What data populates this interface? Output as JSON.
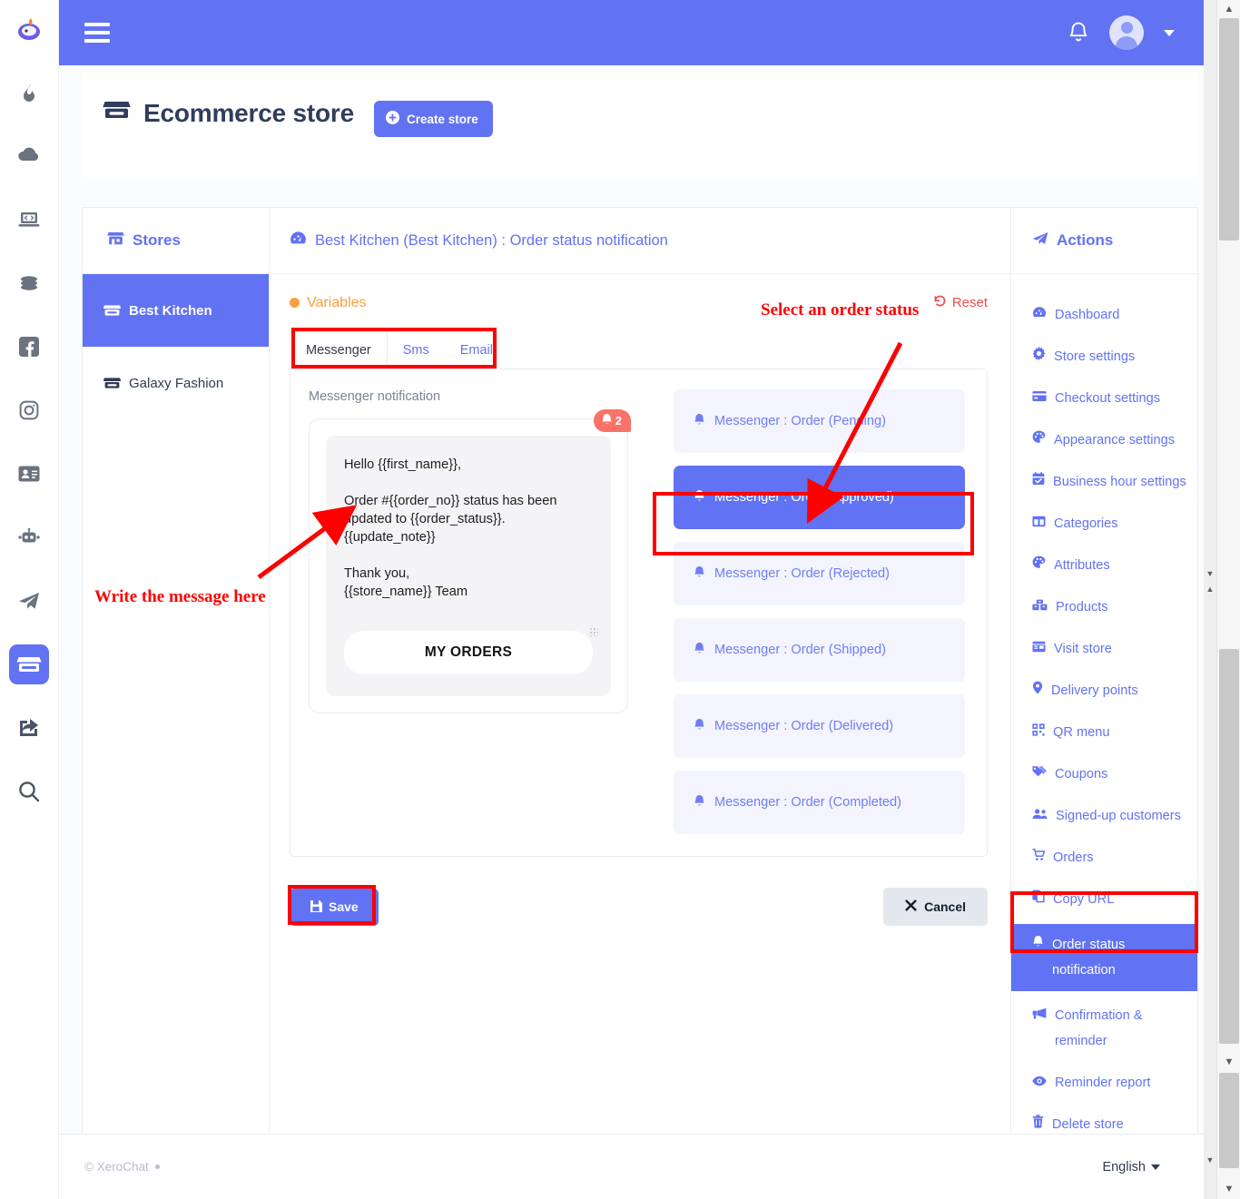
{
  "rail": {
    "items": [
      {
        "name": "xerochat-logo-icon",
        "label": "XeroChat"
      },
      {
        "name": "fire-icon",
        "label": "Hot"
      },
      {
        "name": "cloud-download-icon",
        "label": "Downloads"
      },
      {
        "name": "laptop-code-icon",
        "label": "Developer"
      },
      {
        "name": "coins-icon",
        "label": "Billing"
      },
      {
        "name": "facebook-icon",
        "label": "Facebook"
      },
      {
        "name": "instagram-icon",
        "label": "Instagram"
      },
      {
        "name": "address-card-icon",
        "label": "Contacts"
      },
      {
        "name": "robot-icon",
        "label": "Bot"
      },
      {
        "name": "telegram-icon",
        "label": "Telegram"
      },
      {
        "name": "store-icon",
        "label": "Ecommerce store"
      },
      {
        "name": "share-square-icon",
        "label": "Share"
      },
      {
        "name": "search-icon",
        "label": "Search"
      }
    ],
    "active_index": 10
  },
  "topbar": {
    "menu_toggle": "menu-icon",
    "notifications": "bell-icon",
    "avatar": "user-avatar"
  },
  "header": {
    "title": "Ecommerce store",
    "title_icon": "store-icon",
    "create_store_label": "Create store",
    "create_store_icon": "plus-circle-icon"
  },
  "stores_panel": {
    "heading": "Stores",
    "heading_icon": "store-icon",
    "items": [
      {
        "label": "Best Kitchen",
        "icon": "store-icon",
        "selected": true
      },
      {
        "label": "Galaxy Fashion",
        "icon": "store-icon",
        "selected": false
      }
    ]
  },
  "content": {
    "breadcrumb": "Best Kitchen (Best Kitchen) : Order status notification",
    "breadcrumb_icon": "dashboard-icon",
    "variables_label": "Variables",
    "reset_label": "Reset",
    "reset_icon": "undo-icon",
    "tabs": [
      {
        "label": "Messenger",
        "active": true
      },
      {
        "label": "Sms",
        "active": false
      },
      {
        "label": "Email",
        "active": false
      }
    ],
    "panel_label": "Messenger notification",
    "badge_count": "2",
    "badge_icon": "bell-icon",
    "message_text": "Hello {{first_name}},\n\nOrder #{{order_no}} status has been updated to {{order_status}}.\n{{update_note}}\n\nThank you,\n{{store_name}} Team",
    "my_orders_label": "MY ORDERS",
    "statuses": [
      {
        "label": "Messenger : Order (Pending)",
        "selected": false
      },
      {
        "label": "Messenger : Order (Approved)",
        "selected": true
      },
      {
        "label": "Messenger : Order (Rejected)",
        "selected": false
      },
      {
        "label": "Messenger : Order (Shipped)",
        "selected": false
      },
      {
        "label": "Messenger : Order (Delivered)",
        "selected": false
      },
      {
        "label": "Messenger : Order (Completed)",
        "selected": false
      }
    ],
    "save_label": "Save",
    "save_icon": "save-icon",
    "cancel_label": "Cancel",
    "cancel_icon": "close-icon"
  },
  "actions_panel": {
    "heading": "Actions",
    "heading_icon": "paper-plane-icon",
    "items": [
      {
        "label": "Dashboard",
        "icon": "dashboard-icon",
        "selected": false
      },
      {
        "label": "Store settings",
        "icon": "gear-icon",
        "selected": false
      },
      {
        "label": "Checkout settings",
        "icon": "credit-card-icon",
        "selected": false
      },
      {
        "label": "Appearance settings",
        "icon": "palette-icon",
        "selected": false
      },
      {
        "label": "Business hour settings",
        "icon": "calendar-check-icon",
        "selected": false
      },
      {
        "label": "Categories",
        "icon": "columns-icon",
        "selected": false
      },
      {
        "label": "Attributes",
        "icon": "palette-icon",
        "selected": false
      },
      {
        "label": "Products",
        "icon": "boxes-icon",
        "selected": false
      },
      {
        "label": "Visit store",
        "icon": "window-icon",
        "selected": false
      },
      {
        "label": "Delivery points",
        "icon": "map-pin-icon",
        "selected": false
      },
      {
        "label": "QR menu",
        "icon": "qrcode-icon",
        "selected": false
      },
      {
        "label": "Coupons",
        "icon": "tags-icon",
        "selected": false
      },
      {
        "label": "Signed-up customers",
        "icon": "users-icon",
        "selected": false
      },
      {
        "label": "Orders",
        "icon": "cart-icon",
        "selected": false
      },
      {
        "label": "Copy URL",
        "icon": "copy-icon",
        "selected": false
      },
      {
        "label": "Order status notification",
        "icon": "bell-icon",
        "selected": true
      },
      {
        "label": "Confirmation & reminder",
        "icon": "megaphone-icon",
        "selected": false
      },
      {
        "label": "Reminder report",
        "icon": "eye-icon",
        "selected": false
      },
      {
        "label": "Delete store",
        "icon": "trash-icon",
        "selected": false
      }
    ]
  },
  "footer": {
    "copyright": "© XeroChat",
    "language": "English"
  },
  "annotations": [
    {
      "text": "Select an order status"
    },
    {
      "text": "Write the message here"
    }
  ],
  "colors": {
    "primary": "#6172f3",
    "accent_orange": "#f9a03f",
    "danger": "#ef4c4c",
    "annotation_red": "#fe0000",
    "badge": "#fa7268"
  }
}
